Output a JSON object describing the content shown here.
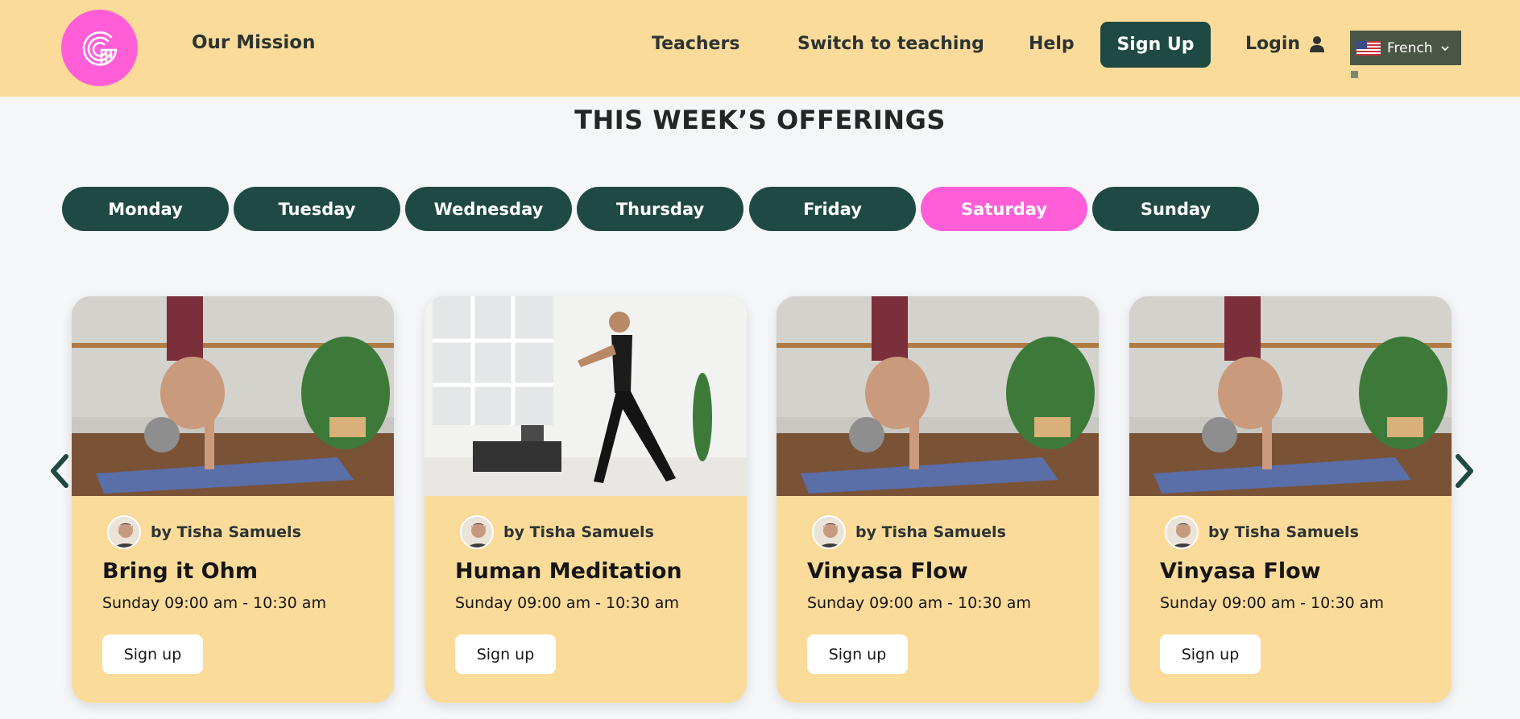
{
  "header": {
    "logo_name": "gather-logo",
    "mission_label": "Our Mission",
    "nav": {
      "teachers": "Teachers",
      "switch": "Switch to teaching",
      "help": "Help"
    },
    "signup_label": "Sign Up",
    "login_label": "Login",
    "language": "French"
  },
  "page_title": "THIS WEEK’S OFFERINGS",
  "days": {
    "selected": "Saturday",
    "items": [
      "Monday",
      "Tuesday",
      "Wednesday",
      "Thursday",
      "Friday",
      "Saturday",
      "Sunday"
    ]
  },
  "cards": [
    {
      "image": "yoga-handstand-photo",
      "author": "by Tisha Samuels",
      "title": "Bring it Ohm",
      "time": "Sunday 09:00 am - 10:30 am",
      "button": "Sign up"
    },
    {
      "image": "man-stretching-photo",
      "author": "by Tisha Samuels",
      "title": "Human Meditation",
      "time": "Sunday 09:00 am - 10:30 am",
      "button": "Sign up"
    },
    {
      "image": "yoga-handstand-photo",
      "author": "by Tisha Samuels",
      "title": "Vinyasa Flow",
      "time": "Sunday 09:00 am - 10:30 am",
      "button": "Sign up"
    },
    {
      "image": "yoga-handstand-photo",
      "author": "by Tisha Samuels",
      "title": "Vinyasa Flow",
      "time": "Sunday 09:00 am - 10:30 am",
      "button": "Sign up"
    }
  ],
  "colors": {
    "header_bg": "#fadb9a",
    "brand_pink": "#ff5ed7",
    "dark_green": "#1f4a43",
    "card_bg": "#fadb9a"
  }
}
